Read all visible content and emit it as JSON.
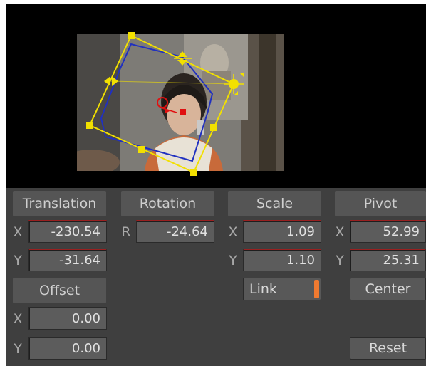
{
  "headers": {
    "translation": "Translation",
    "rotation": "Rotation",
    "scale": "Scale",
    "pivot": "Pivot",
    "offset": "Offset"
  },
  "axis_labels": {
    "x": "X",
    "y": "Y",
    "r": "R"
  },
  "translation": {
    "x": "-230.54",
    "y": "-31.64"
  },
  "rotation": {
    "r": "-24.64"
  },
  "scale": {
    "x": "1.09",
    "y": "1.10"
  },
  "pivot": {
    "x": "52.99",
    "y": "25.31"
  },
  "offset": {
    "x": "0.00",
    "y": "0.00"
  },
  "buttons": {
    "link": "Link",
    "center": "Center",
    "reset": "Reset"
  },
  "colors": {
    "panel_bg": "#3f3f3f",
    "header_bg": "#555555",
    "field_bg": "#5c5c5c",
    "handle_yellow": "#f2e000",
    "mask_blue": "#2030c0",
    "marker_red": "#e01010",
    "link_accent": "#f07a30"
  }
}
